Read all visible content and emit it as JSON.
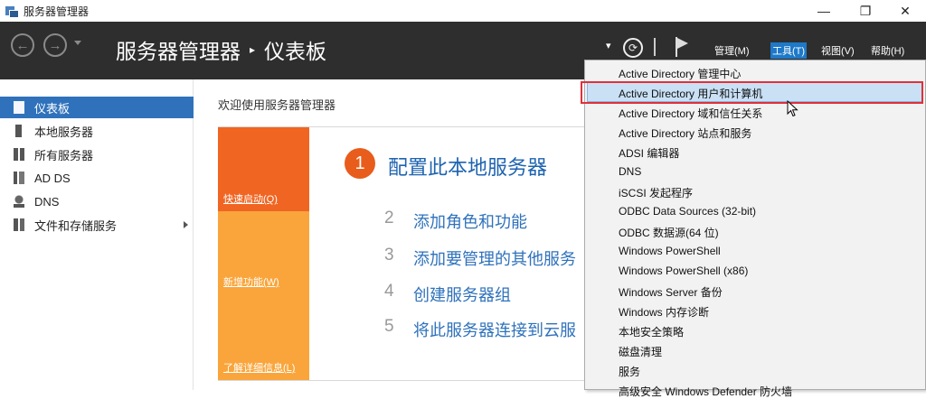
{
  "titlebar": {
    "title": "服务器管理器",
    "min": "—",
    "restore": "❐",
    "close": "✕"
  },
  "header": {
    "back_glyph": "←",
    "forward_glyph": "→",
    "crumb_root": "服务器管理器",
    "crumb_sep": "▸",
    "crumb_page": "仪表板",
    "dropdown_glyph": "▾",
    "refresh_glyph": "⟳",
    "menus": {
      "manage": "管理(M)",
      "tools": "工具(T)",
      "view": "视图(V)",
      "help": "帮助(H)"
    }
  },
  "sidebar": {
    "items": [
      {
        "label": "仪表板"
      },
      {
        "label": "本地服务器"
      },
      {
        "label": "所有服务器"
      },
      {
        "label": "AD DS"
      },
      {
        "label": "DNS"
      },
      {
        "label": "文件和存储服务"
      }
    ]
  },
  "main": {
    "welcome": "欢迎使用服务器管理器",
    "tiles": {
      "quick_start": "快速启动(Q)",
      "whats_new": "新增功能(W)",
      "learn_more": "了解详细信息(L)"
    },
    "steps": [
      {
        "num": "1",
        "text": "配置此本地服务器"
      },
      {
        "num": "2",
        "text": "添加角色和功能"
      },
      {
        "num": "3",
        "text": "添加要管理的其他服务"
      },
      {
        "num": "4",
        "text": "创建服务器组"
      },
      {
        "num": "5",
        "text": "将此服务器连接到云服"
      }
    ]
  },
  "tools_menu": {
    "items": [
      "Active Directory 管理中心",
      "Active Directory 用户和计算机",
      "Active Directory 域和信任关系",
      "Active Directory 站点和服务",
      "ADSI 编辑器",
      "DNS",
      "iSCSI 发起程序",
      "ODBC Data Sources (32-bit)",
      "ODBC 数据源(64 位)",
      "Windows PowerShell",
      "Windows PowerShell (x86)",
      "Windows Server 备份",
      "Windows 内存诊断",
      "本地安全策略",
      "磁盘清理",
      "服务",
      "高级安全 Windows Defender 防火墙"
    ],
    "highlighted_index": 1
  },
  "colors": {
    "accent": "#2f72bb",
    "header_bg": "#2e2e2e",
    "tile_orange": "#f16522",
    "tile_amber": "#f9a53b",
    "highlight_border": "#e0303a"
  }
}
